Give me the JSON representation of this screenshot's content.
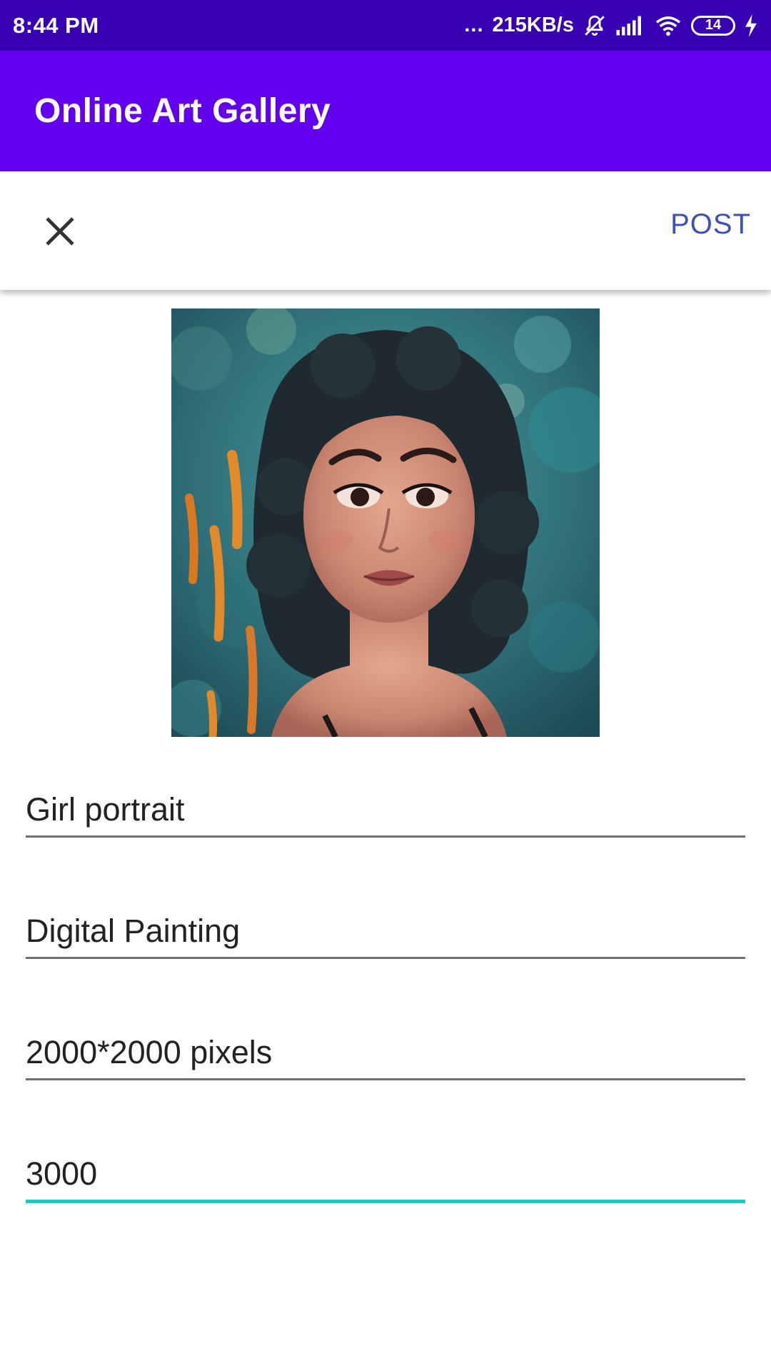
{
  "status_bar": {
    "time": "8:44 PM",
    "dots": "...",
    "network_speed": "215KB/s",
    "battery_level": "14",
    "icons": [
      "mute-icon",
      "signal-icon",
      "wifi-icon",
      "battery-icon",
      "charging-icon"
    ]
  },
  "app_bar": {
    "title": "Online Art Gallery",
    "color": "#6200ee"
  },
  "action_bar": {
    "close_icon": "close-icon",
    "post_label": "POST",
    "post_color": "#3f51b5"
  },
  "artwork": {
    "icon": "artwork-image"
  },
  "form": {
    "title_value": "Girl portrait",
    "category_value": "Digital Painting",
    "size_value": "2000*2000 pixels",
    "price_value": "3000",
    "active_underline_color": "#1fc8bf"
  }
}
